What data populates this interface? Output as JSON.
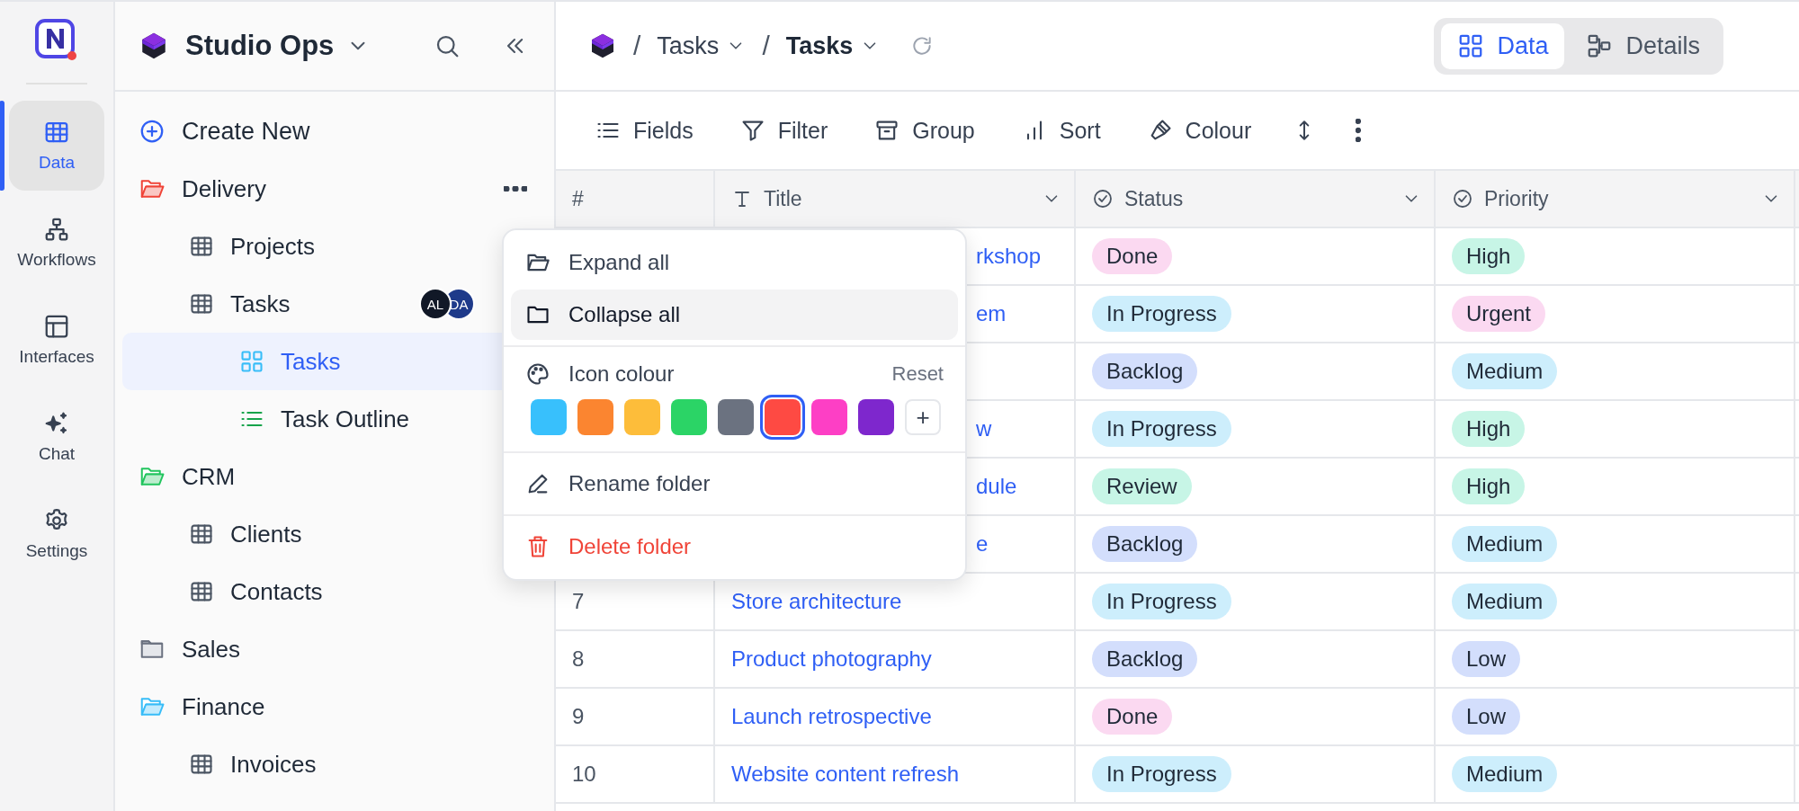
{
  "rail": {
    "items": [
      {
        "label": "Data",
        "selected": true
      },
      {
        "label": "Workflows",
        "selected": false
      },
      {
        "label": "Interfaces",
        "selected": false
      },
      {
        "label": "Chat",
        "selected": false
      },
      {
        "label": "Settings",
        "selected": false
      }
    ]
  },
  "sidebar": {
    "workspace": "Studio Ops",
    "create_label": "Create New",
    "items": [
      {
        "label": "Delivery",
        "kind": "folder",
        "color": "#f04438",
        "expanded": true,
        "selected": false,
        "children": [
          {
            "label": "Projects",
            "kind": "table",
            "selected": false
          },
          {
            "label": "Tasks",
            "kind": "table",
            "selected": false,
            "avatars": [
              "AL",
              "DA"
            ],
            "children": [
              {
                "label": "Tasks",
                "kind": "grid",
                "selected": true
              },
              {
                "label": "Task Outline",
                "kind": "list",
                "selected": false
              }
            ]
          }
        ]
      },
      {
        "label": "CRM",
        "kind": "folder",
        "color": "#22c55e",
        "expanded": true,
        "selected": false,
        "children": [
          {
            "label": "Clients",
            "kind": "table",
            "selected": false
          },
          {
            "label": "Contacts",
            "kind": "table",
            "selected": false
          }
        ]
      },
      {
        "label": "Sales",
        "kind": "folder",
        "color": "#6b7280",
        "expanded": false,
        "selected": false
      },
      {
        "label": "Finance",
        "kind": "folder",
        "color": "#38bdf8",
        "expanded": true,
        "selected": false,
        "children": [
          {
            "label": "Invoices",
            "kind": "table",
            "selected": false
          }
        ]
      }
    ]
  },
  "header": {
    "breadcrumb": [
      {
        "separator": "/",
        "label": "Tasks",
        "current": false
      },
      {
        "separator": "/",
        "label": "Tasks",
        "current": true
      }
    ],
    "views": [
      {
        "label": "Data",
        "selected": true
      },
      {
        "label": "Details",
        "selected": false
      }
    ]
  },
  "toolbar": [
    {
      "label": "Fields"
    },
    {
      "label": "Filter"
    },
    {
      "label": "Group"
    },
    {
      "label": "Sort"
    },
    {
      "label": "Colour"
    }
  ],
  "table": {
    "columns": [
      {
        "label": "#"
      },
      {
        "label": "Title"
      },
      {
        "label": "Status"
      },
      {
        "label": "Priority"
      }
    ],
    "rows": [
      {
        "title": "rkshop",
        "status": {
          "label": "Done",
          "color": "#fbd9f1"
        },
        "priority": {
          "label": "High",
          "color": "#c7f5e6"
        }
      },
      {
        "title": "em",
        "status": {
          "label": "In Progress",
          "color": "#cdeefc"
        },
        "priority": {
          "label": "Urgent",
          "color": "#fbd9f1"
        }
      },
      {
        "status": {
          "label": "Backlog",
          "color": "#d3defc"
        },
        "priority": {
          "label": "Medium",
          "color": "#cdeefc"
        }
      },
      {
        "title": "w",
        "status": {
          "label": "In Progress",
          "color": "#cdeefc"
        },
        "priority": {
          "label": "High",
          "color": "#c7f5e6"
        }
      },
      {
        "title": "dule",
        "status": {
          "label": "Review",
          "color": "#c7f5e6"
        },
        "priority": {
          "label": "High",
          "color": "#c7f5e6"
        }
      },
      {
        "title": "e",
        "status": {
          "label": "Backlog",
          "color": "#d3defc"
        },
        "priority": {
          "label": "Medium",
          "color": "#cdeefc"
        }
      },
      {
        "number": "7",
        "title": "Store architecture",
        "status": {
          "label": "In Progress",
          "color": "#cdeefc"
        },
        "priority": {
          "label": "Medium",
          "color": "#cdeefc"
        }
      },
      {
        "number": "8",
        "title": "Product photography",
        "status": {
          "label": "Backlog",
          "color": "#d3defc"
        },
        "priority": {
          "label": "Low",
          "color": "#d3defc"
        }
      },
      {
        "number": "9",
        "title": "Launch retrospective",
        "status": {
          "label": "Done",
          "color": "#fbd9f1"
        },
        "priority": {
          "label": "Low",
          "color": "#d3defc"
        }
      },
      {
        "number": "10",
        "title": "Website content refresh",
        "status": {
          "label": "In Progress",
          "color": "#cdeefc"
        },
        "priority": {
          "label": "Medium",
          "color": "#cdeefc"
        }
      }
    ]
  },
  "menu": {
    "actions_top": [
      {
        "label": "Expand all",
        "highlighted": false
      },
      {
        "label": "Collapse all",
        "highlighted": true
      }
    ],
    "colour_label": "Icon colour",
    "reset_label": "Reset",
    "swatches": [
      {
        "color": "#38c0fc",
        "selected": false
      },
      {
        "color": "#fb8530",
        "selected": false
      },
      {
        "color": "#fdbd3a",
        "selected": false
      },
      {
        "color": "#2bd466",
        "selected": false
      },
      {
        "color": "#6b7280",
        "selected": false
      },
      {
        "color": "#fe4a43",
        "selected": true
      },
      {
        "color": "#fd3fc5",
        "selected": false
      },
      {
        "color": "#7e27cd",
        "selected": false
      }
    ],
    "add_label": "+",
    "actions_bottom": [
      {
        "label": "Rename folder",
        "kind": "normal"
      },
      {
        "label": "Delete folder",
        "kind": "danger"
      }
    ]
  }
}
